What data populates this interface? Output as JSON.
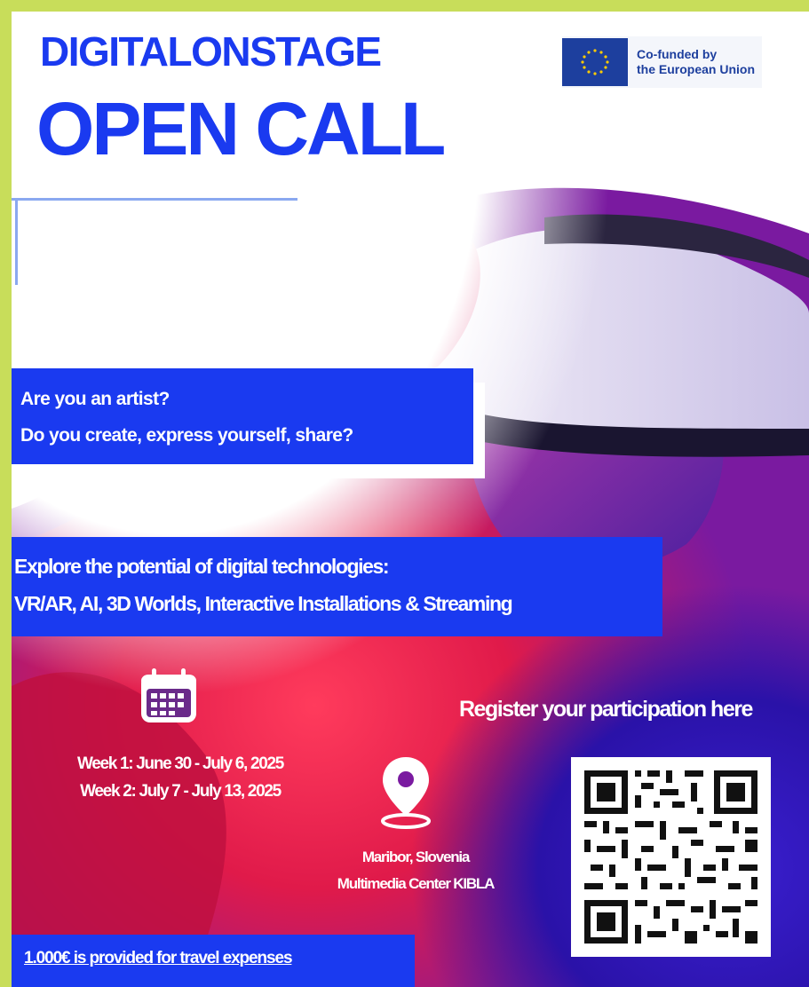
{
  "header": {
    "title_small": "DIGITALONSTAGE",
    "title_large": "OPEN CALL"
  },
  "funding": {
    "line1": "Co-funded by",
    "line2": "the European Union",
    "flag_icon": "eu-flag-icon"
  },
  "questions": {
    "line1": "Are you an artist?",
    "line2": "Do you create, express yourself, share?"
  },
  "technologies": {
    "line1": "Explore the potential of digital technologies:",
    "line2": "VR/AR, AI, 3D Worlds, Interactive Installations & Streaming"
  },
  "schedule": {
    "icon": "calendar-icon",
    "week1": "Week 1: June 30 - July 6, 2025",
    "week2": "Week 2: July 7 - July 13, 2025"
  },
  "location": {
    "icon": "map-pin-icon",
    "city": "Maribor, Slovenia",
    "venue": "Multimedia Center KIBLA"
  },
  "registration": {
    "label": "Register your participation here",
    "qr_icon": "qr-code-icon"
  },
  "travel": {
    "label": "1.000€ is provided for travel expenses"
  },
  "colors": {
    "border": "#c8dd5a",
    "brand_blue": "#1a3af0",
    "eu_blue": "#1d3f9e",
    "eu_gold": "#ffcc00"
  }
}
